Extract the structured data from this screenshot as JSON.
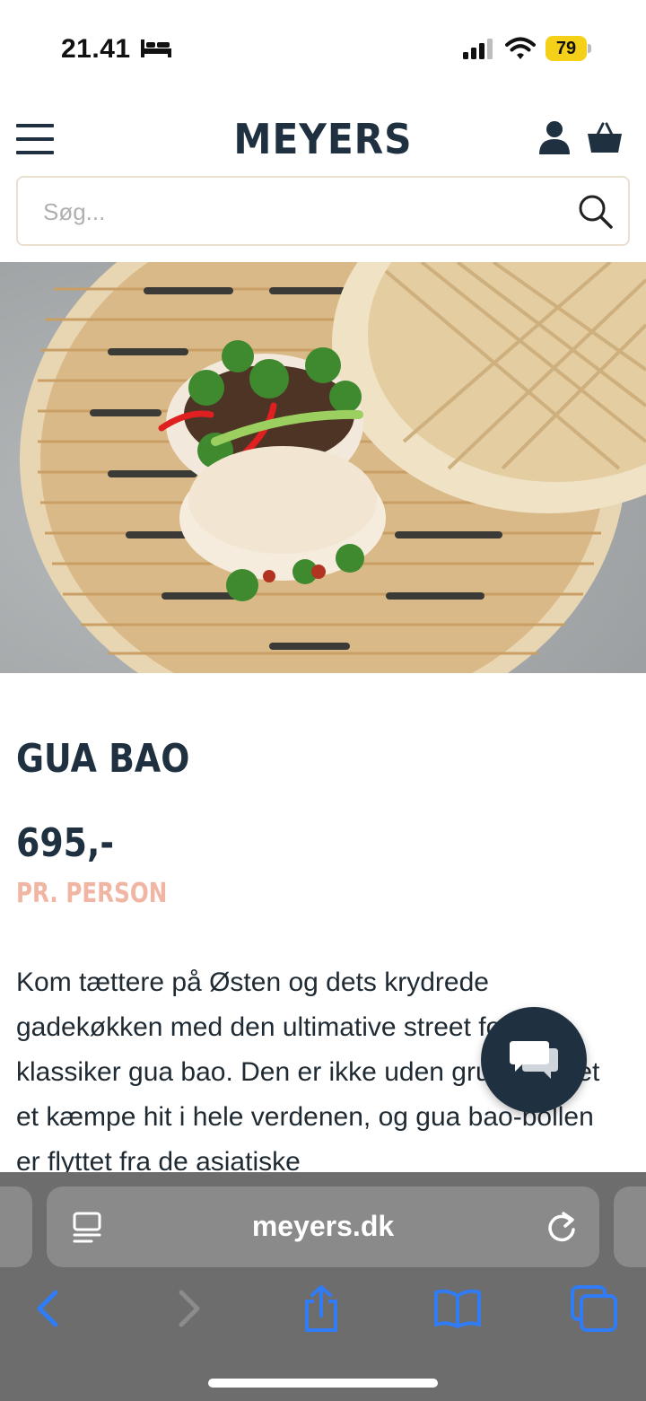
{
  "status_bar": {
    "time": "21.41",
    "battery": "79",
    "icons": [
      "bed-icon",
      "signal-icon",
      "wifi-icon",
      "battery-icon"
    ]
  },
  "header": {
    "logo": "MEYERS",
    "icons": [
      "menu-icon",
      "user-icon",
      "basket-icon"
    ],
    "search": {
      "placeholder": "Søg...",
      "value": ""
    }
  },
  "hero": {
    "icon": "bao-buns-in-bamboo-steamer-image"
  },
  "product": {
    "title": "GUA BAO",
    "price": "695,-",
    "price_unit": "PR. PERSON",
    "description": "Kom tættere på Østen og dets krydrede gadekøkken med den ultimative street food-klassiker gua bao. Den er ikke uden grund blevet et kæmpe hit i hele verdenen, og gua bao-bollen er flyttet fra de asiatiske"
  },
  "chat": {
    "icon": "chat-bubbles-icon"
  },
  "browser": {
    "url": "meyers.dk",
    "icons": [
      "reader-mode-icon",
      "reload-icon",
      "back-icon",
      "forward-icon",
      "share-icon",
      "bookmarks-icon",
      "tabs-icon"
    ]
  },
  "colors": {
    "brand_navy": "#1f3140",
    "accent_salmon": "#f0b6a3",
    "search_border": "#e9e0cf",
    "browser_gray": "#6d6d6d",
    "ios_blue": "#2f7cf6",
    "battery_yellow": "#f5d018"
  }
}
